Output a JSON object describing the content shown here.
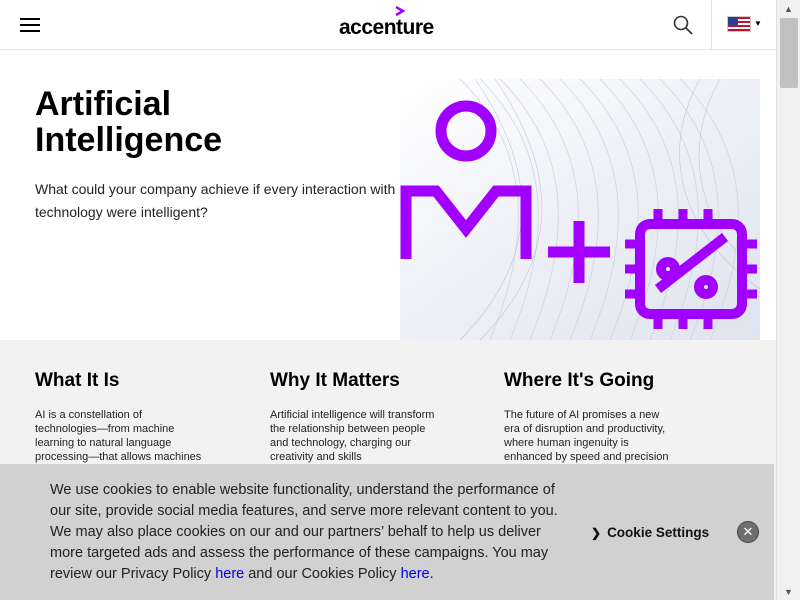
{
  "header": {
    "logo_text": "accenture",
    "accent_color": "#a100ff",
    "menu_icon": "hamburger-icon",
    "search_icon": "search-icon",
    "flag_icon": "us-flag-icon"
  },
  "hero": {
    "title_line1": "Artificial",
    "title_line2": "Intelligence",
    "subtitle": "What could your company achieve if every interaction with technology were intelligent?"
  },
  "columns": [
    {
      "title": "What It Is",
      "text": "AI is a constellation of technologies—from machine learning to natural language processing—that allows machines to sense,"
    },
    {
      "title": "Why It Matters",
      "text": "Artificial intelligence will transform the relationship between people and technology, charging our creativity and skills"
    },
    {
      "title": "Where It's Going",
      "text": "The future of AI promises a new era of disruption and productivity, where human ingenuity is enhanced by speed and precision"
    }
  ],
  "cookie": {
    "text_main": "We use cookies to enable website functionality, understand the performance of our site, provide social media features, and serve more relevant content to you. We may also place cookies on our and our partners’ behalf to help us deliver more targeted ads and assess the performance of these campaigns. You may review our Privacy Policy ",
    "link1": "here",
    "text_mid": " and our Cookies Policy ",
    "link2": "here",
    "text_end": ".",
    "settings_label": "Cookie Settings",
    "close_label": "✕"
  }
}
